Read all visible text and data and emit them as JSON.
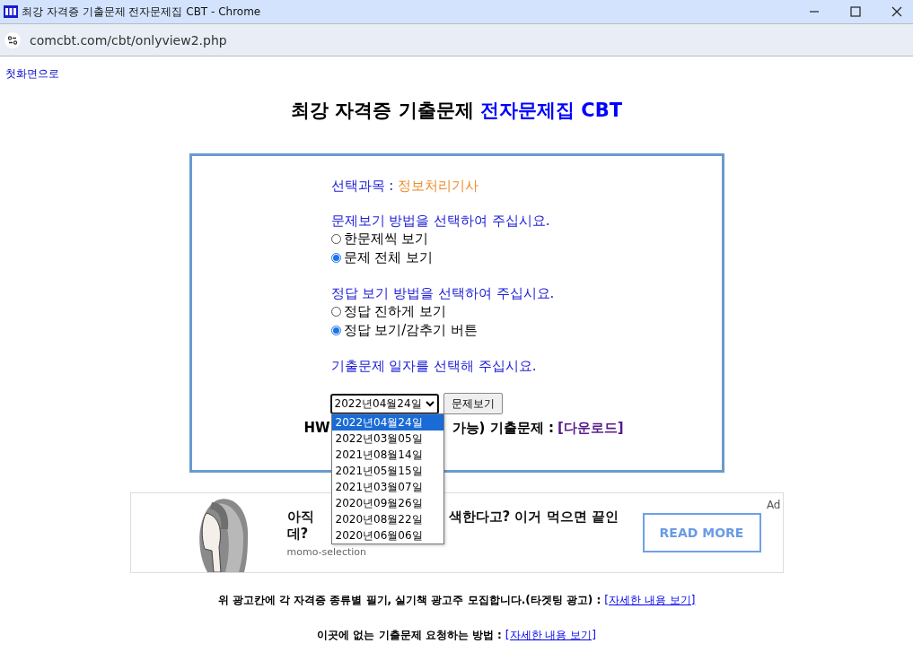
{
  "window": {
    "title": "최강 자격증 기출문제 전자문제집 CBT - Chrome",
    "url": "comcbt.com/cbt/onlyview2.php"
  },
  "top_link": "첫화면으로",
  "heading": {
    "main": "최강 자격증 기출문제",
    "accent": "전자문제집 CBT"
  },
  "form": {
    "subject_label": "선택과목 :",
    "subject": "정보처리기사",
    "groups": [
      {
        "prompt": "문제보기 방법을 선택하여 주십시요.",
        "options": [
          {
            "label": "한문제씩 보기",
            "selected": false
          },
          {
            "label": "문제 전체 보기",
            "selected": true
          }
        ]
      },
      {
        "prompt": "정답 보기 방법을 선택하여 주십시요.",
        "options": [
          {
            "label": "정답 진하게 보기",
            "selected": false
          },
          {
            "label": "정답 보기/감추기 버튼",
            "selected": true
          }
        ]
      }
    ],
    "date_prompt": "기출문제 일자를 선택해 주십시요.",
    "date_select": {
      "value": "2022년04월24일",
      "expanded": true,
      "options": [
        {
          "label": "2022년04월24일",
          "selected": true
        },
        {
          "label": "2022년03월05일",
          "selected": false
        },
        {
          "label": "2021년08월14일",
          "selected": false
        },
        {
          "label": "2021년05월15일",
          "selected": false
        },
        {
          "label": "2021년03월07일",
          "selected": false
        },
        {
          "label": "2020년09월26일",
          "selected": false
        },
        {
          "label": "2020년08월22일",
          "selected": false
        },
        {
          "label": "2020년06월06일",
          "selected": false
        }
      ]
    },
    "view_button": "문제보기",
    "download": {
      "lead": "HW",
      "tail": "가능) 기출문제 :",
      "link": "[다운로드]"
    }
  },
  "ad": {
    "headline_start": "아직",
    "headline_rest": "색한다고? 이거 먹으면 끝인",
    "headline_end": "데?",
    "source": "momo-selection",
    "button": "READ MORE",
    "label": "Ad"
  },
  "footer": [
    {
      "text": "위 광고칸에 각 자격증 종류별 필기, 실기책 광고주 모집합니다.(타겟팅 광고) :",
      "link": "[자세한 내용 보기]"
    },
    {
      "text": "이곳에 없는 기출문제 요청하는 방법 :",
      "link": "[자세한 내용 보기]"
    }
  ]
}
